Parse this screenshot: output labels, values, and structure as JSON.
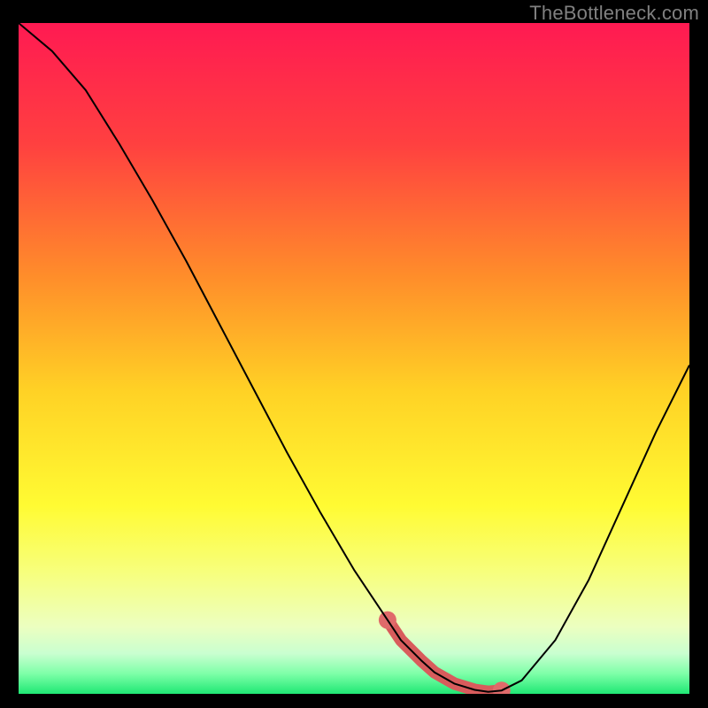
{
  "watermark": "TheBottleneck.com",
  "colors": {
    "background": "#000000",
    "curve": "#000000",
    "marker_fill": "#e06a6a",
    "marker_stroke": "#d85c5c"
  },
  "chart_data": {
    "type": "line",
    "title": "",
    "xlabel": "",
    "ylabel": "",
    "xlim": [
      0,
      100
    ],
    "ylim": [
      0,
      100
    ],
    "x": [
      0,
      5,
      10,
      15,
      20,
      25,
      30,
      35,
      40,
      45,
      50,
      55,
      57,
      60,
      62,
      65,
      68,
      70,
      72,
      75,
      80,
      85,
      90,
      95,
      100
    ],
    "y": [
      100,
      95.8,
      90,
      82,
      73.5,
      64.5,
      55,
      45.5,
      36,
      27,
      18.5,
      11,
      8,
      5,
      3.2,
      1.5,
      0.6,
      0.3,
      0.5,
      2,
      8,
      17,
      28,
      39,
      49
    ],
    "markers": {
      "x": [
        55,
        57,
        60,
        62,
        65,
        68,
        70,
        72
      ],
      "y": [
        11,
        8,
        5,
        3.2,
        1.5,
        0.6,
        0.3,
        0.5
      ]
    },
    "gradient_stops": [
      {
        "pct": 0,
        "color": "#ff1a52"
      },
      {
        "pct": 18,
        "color": "#ff4040"
      },
      {
        "pct": 38,
        "color": "#ff8e2a"
      },
      {
        "pct": 55,
        "color": "#ffd225"
      },
      {
        "pct": 72,
        "color": "#fffb33"
      },
      {
        "pct": 82,
        "color": "#f7ff7e"
      },
      {
        "pct": 90,
        "color": "#ecffc0"
      },
      {
        "pct": 94,
        "color": "#c9ffd0"
      },
      {
        "pct": 97,
        "color": "#7effa8"
      },
      {
        "pct": 100,
        "color": "#1fe874"
      }
    ]
  }
}
